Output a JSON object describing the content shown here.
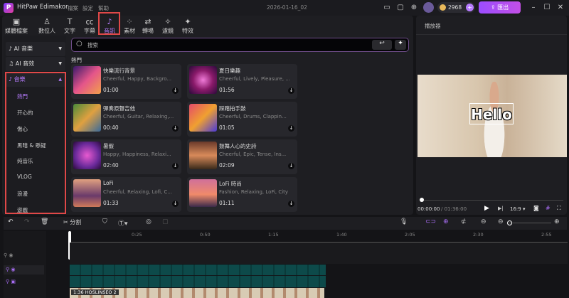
{
  "app": {
    "title": "HitPaw Edimakor",
    "menus": [
      "檔案",
      "設定",
      "幫助"
    ],
    "project": "2026-01-16_02",
    "coins": "2968",
    "export_label": "匯出"
  },
  "tabs": [
    {
      "label": "媒體檔案",
      "icon": "media-icon"
    },
    {
      "label": "數位人",
      "icon": "avatar-icon"
    },
    {
      "label": "文字",
      "icon": "text-icon"
    },
    {
      "label": "字幕",
      "icon": "caption-icon"
    },
    {
      "label": "音訊",
      "icon": "music-icon",
      "active": true
    },
    {
      "label": "素材",
      "icon": "elements-icon"
    },
    {
      "label": "轉場",
      "icon": "transition-icon"
    },
    {
      "label": "濾鏡",
      "icon": "filter-icon"
    },
    {
      "label": "特效",
      "icon": "effects-icon"
    }
  ],
  "sidebar": {
    "ai_music": "AI 音樂",
    "ai_sfx": "AI 音效",
    "music": "音樂",
    "items": [
      "熱門",
      "开心的",
      "傷心",
      "黑暗 & 懸疑",
      "纯音乐",
      "VLOG",
      "浪漫",
      "遊戲"
    ],
    "active": "熱門"
  },
  "search": {
    "placeholder": "搜索"
  },
  "section_title": "熱門",
  "tracks": [
    {
      "name": "快樂流行背景",
      "tags": "Cheerful, Happy, Backgro...",
      "duration": "01:00"
    },
    {
      "name": "夏日樂趣",
      "tags": "Cheerful, Lively, Pleasure, ...",
      "duration": "01:56"
    },
    {
      "name": "彈奏原聲吉他",
      "tags": "Cheerful, Guitar, Relaxing,...",
      "duration": "00:40"
    },
    {
      "name": "踩踏拍手鼓",
      "tags": "Cheerful, Drums, Clappin...",
      "duration": "01:05"
    },
    {
      "name": "暑假",
      "tags": "Happy, Happiness, Relaxi...",
      "duration": "02:40"
    },
    {
      "name": "鼓舞人心的史詩",
      "tags": "Cheerful, Epic, Tense, Ins...",
      "duration": "02:09"
    },
    {
      "name": "LoFi",
      "tags": "Cheerful, Relaxing, Lofi, C...",
      "duration": "01:33"
    },
    {
      "name": "LoFi 時尚",
      "tags": "Fashion, Relaxing, LoFi, City",
      "duration": "01:11"
    }
  ],
  "player": {
    "title": "播放器",
    "overlay_text": "Hello",
    "time": "00:00:00",
    "total": "/ 01:36:00",
    "ratio": "16:9"
  },
  "timeline": {
    "split_label": "分割",
    "ticks": [
      "0:25",
      "0:50",
      "1:15",
      "1:40",
      "2:05",
      "2:30",
      "2:55"
    ],
    "clip_label": "1:36 HOSLINSEO 2"
  }
}
